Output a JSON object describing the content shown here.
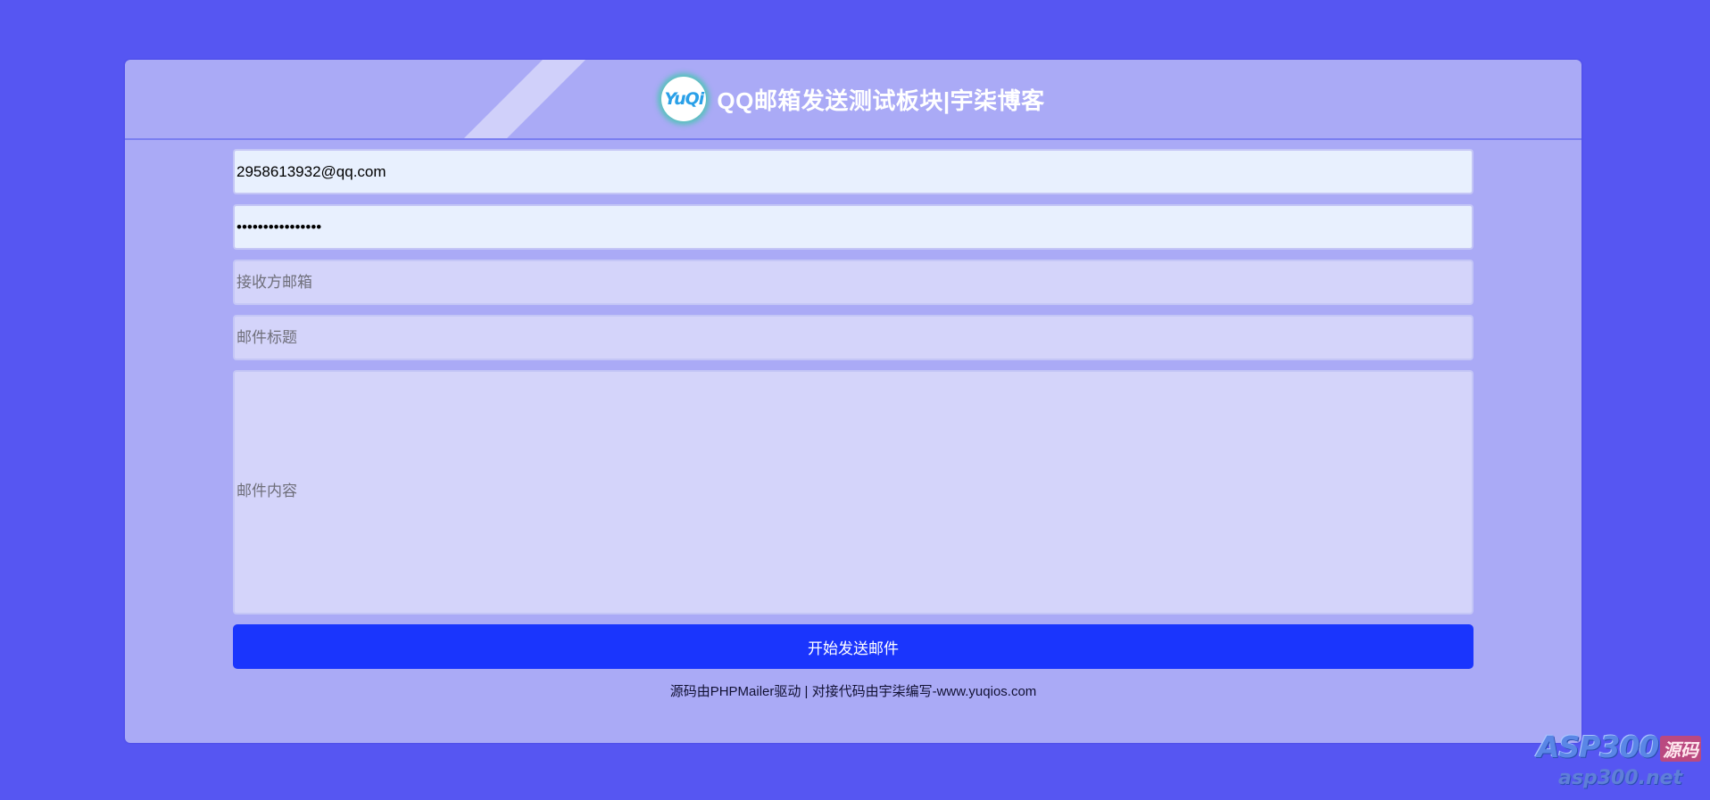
{
  "header": {
    "logo_text": "YuQi",
    "title": "QQ邮箱发送测试板块|宇柒博客"
  },
  "form": {
    "sender_email": {
      "value": "2958613932@qq.com",
      "placeholder": ""
    },
    "auth_code": {
      "value": "qqauthcodepass12",
      "placeholder": ""
    },
    "recipient_email": {
      "value": "",
      "placeholder": "接收方邮箱"
    },
    "subject": {
      "value": "",
      "placeholder": "邮件标题"
    },
    "content": {
      "value": "",
      "placeholder": "邮件内容"
    },
    "submit_label": "开始发送邮件"
  },
  "footer": {
    "note": "源码由PHPMailer驱动 | 对接代码由宇柒编写-www.yuqios.com"
  },
  "watermark": {
    "brand": "ASP300",
    "tag": "源码",
    "domain": "asp300.net"
  },
  "colors": {
    "page_background": "#5656f2",
    "panel_background": "#aaaaf6",
    "button_background": "#1a35fd",
    "input_filled_background": "#e8f0fe",
    "input_empty_background": "#d4d4fa"
  }
}
